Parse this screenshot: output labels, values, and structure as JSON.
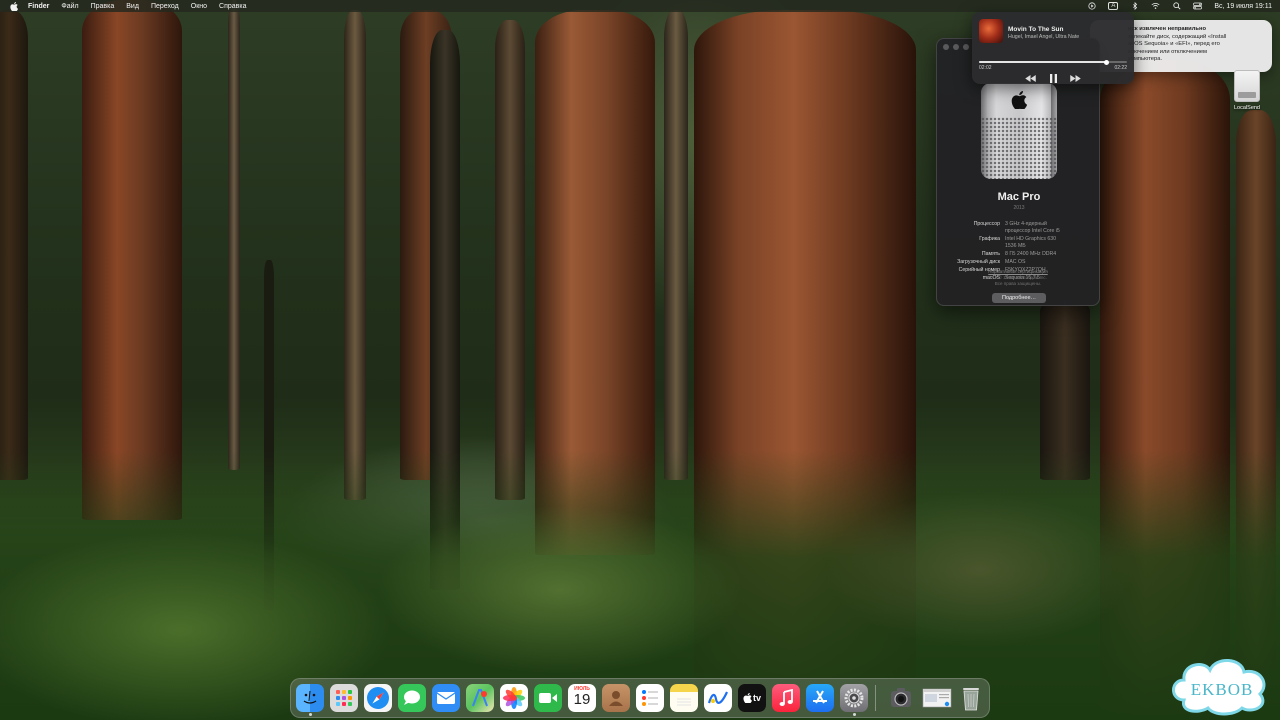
{
  "menubar": {
    "items": [
      "Finder",
      "Файл",
      "Правка",
      "Вид",
      "Переход",
      "Окно",
      "Справка"
    ],
    "clock": "Вс, 19 июля  19:11",
    "input_source": "A"
  },
  "player": {
    "title": "Movin To The Sun",
    "artist": "Hugel, Imael Angel, Ultra Nate",
    "elapsed": "02:02",
    "total": "02:22",
    "progress": 0.86
  },
  "notification": {
    "title": "иск извлечен неправильно",
    "lines": [
      "звлекайте диск, содержащий «Install",
      "acOS Sequoia» и «EFI», перед его",
      "ключением или отключением",
      "компьютера."
    ]
  },
  "about": {
    "model": "Mac Pro",
    "year": "2013",
    "specs": [
      {
        "key": "Процессор",
        "value": "3 GHz 4-ядерный"
      },
      {
        "key": "",
        "value": "процессор Intel Core i5"
      },
      {
        "key": "Графика",
        "value": "Intel HD Graphics 630"
      },
      {
        "key": "",
        "value": "1536 МБ"
      },
      {
        "key": "Память",
        "value": "8 ГБ 2400 MHz DDR4"
      },
      {
        "key": "Загрузочный диск",
        "value": "MAC OS"
      },
      {
        "key": "Серийный номер",
        "value": "F5KYQXZ2P7QH"
      },
      {
        "key": "macOS",
        "value": "Sequoia 15.7.5"
      }
    ],
    "more_label": "Подробнее…",
    "footer_link": "Нормативная сертификация",
    "footer_lines": [
      "™ и © 1983–2026 Apple Inc.",
      "Все права защищены."
    ]
  },
  "desktop": {
    "icons": [
      {
        "label": "LocalSend"
      }
    ]
  },
  "dock": {
    "apps": [
      {
        "name": "Finder",
        "color": "#2d8cf0"
      },
      {
        "name": "Launchpad",
        "color": "#d9d9d9"
      },
      {
        "name": "Safari",
        "color": "#1e8ef2"
      },
      {
        "name": "Messages",
        "color": "#35c759"
      },
      {
        "name": "Mail",
        "color": "#2f8df5"
      },
      {
        "name": "Maps",
        "color": "#5ac35f"
      },
      {
        "name": "Photos",
        "color": "#ffffff"
      },
      {
        "name": "FaceTime",
        "color": "#2fb94b"
      },
      {
        "name": "Calendar",
        "color": "#ffffff"
      },
      {
        "name": "Contacts",
        "color": "#b07a4f"
      },
      {
        "name": "Reminders",
        "color": "#ffffff"
      },
      {
        "name": "Notes",
        "color": "#f5d54b"
      },
      {
        "name": "Freeform",
        "color": "#ffffff"
      },
      {
        "name": "Apple TV",
        "color": "#111111"
      },
      {
        "name": "Music",
        "color": "#fa3d4f"
      },
      {
        "name": "App Store",
        "color": "#1d8af0"
      },
      {
        "name": "System Settings",
        "color": "#8e8e93"
      }
    ],
    "calendar": {
      "month": "ИЮЛЬ",
      "day": "19"
    },
    "tv_label": "tv"
  },
  "watermark": {
    "text": "EKBOB"
  }
}
